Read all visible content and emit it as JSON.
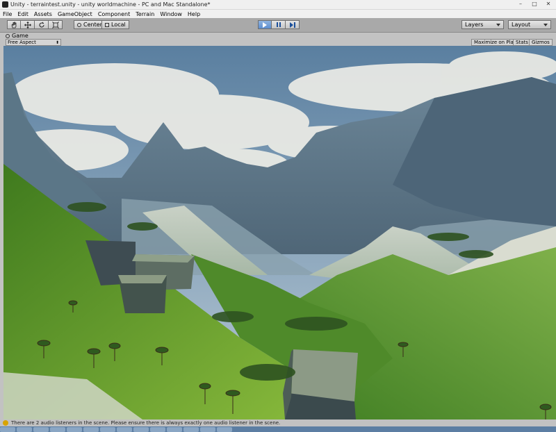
{
  "window": {
    "title": "Unity - terraintest.unity - unity worldmachine - PC and Mac Standalone*",
    "controls": [
      "–",
      "□",
      "✕"
    ]
  },
  "menu": [
    "File",
    "Edit",
    "Assets",
    "GameObject",
    "Component",
    "Terrain",
    "Window",
    "Help"
  ],
  "toolbar": {
    "tools": [
      "hand-tool",
      "move-tool",
      "rotate-tool",
      "scale-tool"
    ],
    "pivot_label": "Center",
    "space_label": "Local",
    "layers_label": "Layers",
    "layout_label": "Layout",
    "play_state": "playing"
  },
  "game_view": {
    "tab_label": "Game",
    "aspect": "Free Aspect",
    "maximize_label": "Maximize on Play",
    "stats_label": "Stats",
    "gizmos_label": "Gizmos"
  },
  "status": {
    "message": "There are 2 audio listeners in the scene. Please ensure there is always exactly one audio listener in the scene."
  },
  "colors": {
    "sky": "#7fa0bd",
    "grass": "#5c9a2a",
    "rock": "#556a7a",
    "play_active": "#5d8ed0"
  }
}
